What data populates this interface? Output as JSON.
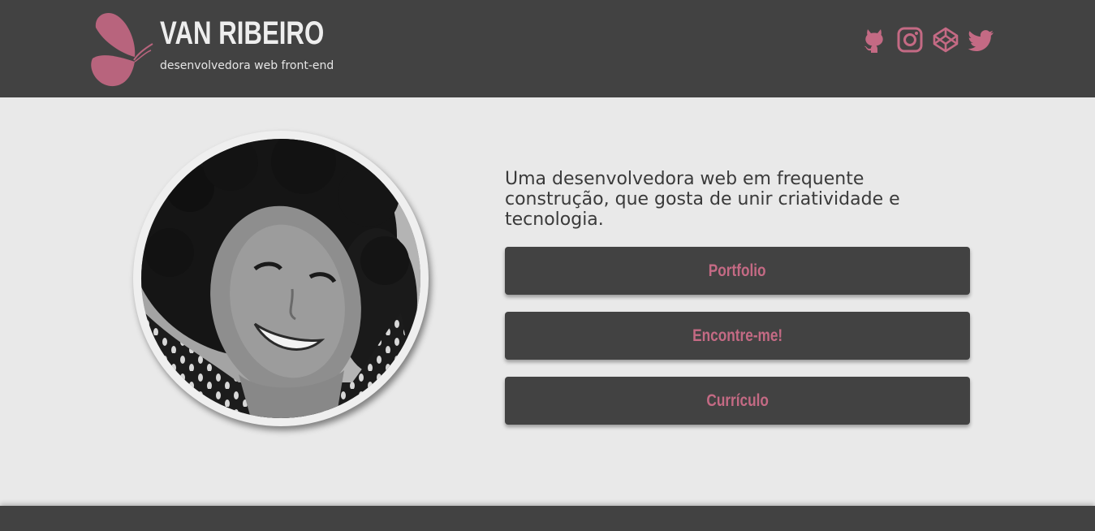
{
  "header": {
    "brand_name": "VAN RIBEIRO",
    "brand_subtitle": "desenvolvedora web front-end",
    "social_links": [
      {
        "name": "github-icon"
      },
      {
        "name": "instagram-icon"
      },
      {
        "name": "codepen-icon"
      },
      {
        "name": "twitter-icon"
      }
    ]
  },
  "main": {
    "bio": "Uma desenvolvedora web em frequente construção, que gosta de unir criatividade e tecnologia.",
    "buttons": [
      {
        "label": "Portfolio"
      },
      {
        "label": "Encontre-me!"
      },
      {
        "label": "Currículo"
      }
    ]
  },
  "colors": {
    "header_bg": "#424242",
    "page_bg": "#e9e9e9",
    "accent": "#c46a84",
    "button_bg": "#424242"
  }
}
